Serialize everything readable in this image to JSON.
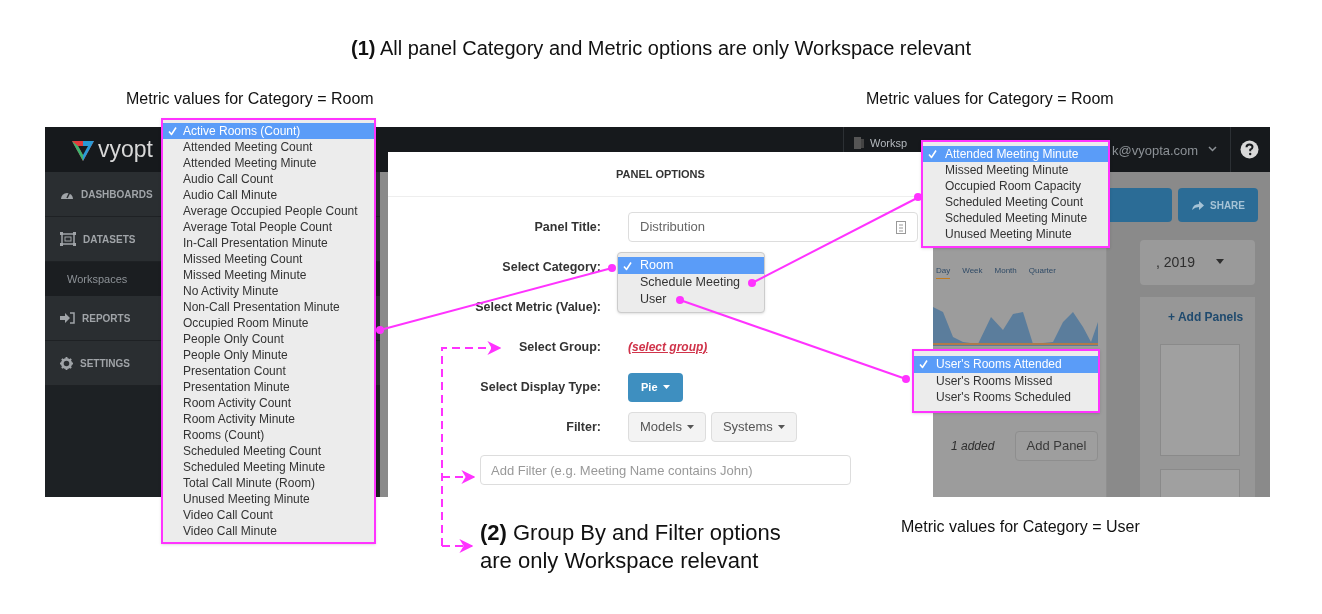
{
  "headline": "**(1)** All panel Category and Metric options are only Workspace relevant",
  "captions": [
    {
      "text": "Metric values for Category = Room"
    },
    {
      "text": "Metric values for Category = Room"
    },
    {
      "text": "Metric values for Category = User"
    }
  ],
  "note": "**(2)** Group By and Filter options\nare only Workspace relevant",
  "app": {
    "logo": "vyopt",
    "workspace": "Worksp",
    "user": "k@vyopta.com",
    "nav": [
      {
        "label": "DASHBOARDS",
        "kind": "gauge"
      },
      {
        "label": "DATASETS",
        "kind": "box"
      },
      {
        "label": "Workspaces",
        "kind": "sub"
      },
      {
        "label": "REPORTS",
        "kind": "enter"
      },
      {
        "label": "SETTINGS",
        "kind": "gear"
      }
    ],
    "share": "SHARE",
    "date": ", 2019",
    "chart_tabs": [
      {
        "label": "Day",
        "selected": true
      },
      {
        "label": "Week",
        "selected": false
      },
      {
        "label": "Month",
        "selected": false
      },
      {
        "label": "Quarter",
        "selected": false
      }
    ],
    "add_panels": "+ Add Panels",
    "added": "1 added",
    "add_panel": "Add Panel"
  },
  "modal": {
    "title": "PANEL OPTIONS",
    "rows": [
      {
        "label": "Panel Title:",
        "kind": "input",
        "value": "Distribution"
      },
      {
        "label": "Select Category:",
        "kind": "none"
      },
      {
        "label": "Select Metric (Value):",
        "kind": "none"
      },
      {
        "label": "Select Group:",
        "kind": "link",
        "value": "(select group)"
      },
      {
        "label": "Select Display Type:",
        "kind": "primary",
        "value": "Pie"
      },
      {
        "label": "Filter:",
        "kind": "buttons",
        "values": [
          "Models",
          "Systems"
        ]
      }
    ],
    "filter_placeholder": "Add Filter (e.g. Meeting Name contains John)"
  },
  "room_metrics": [
    {
      "label": "Active Rooms (Count)",
      "selected": true
    },
    {
      "label": "Attended Meeting Count",
      "selected": false
    },
    {
      "label": "Attended Meeting Minute",
      "selected": false
    },
    {
      "label": "Audio Call Count",
      "selected": false
    },
    {
      "label": "Audio Call Minute",
      "selected": false
    },
    {
      "label": "Average Occupied People Count",
      "selected": false
    },
    {
      "label": "Average Total People Count",
      "selected": false
    },
    {
      "label": "In-Call Presentation Minute",
      "selected": false
    },
    {
      "label": "Missed Meeting Count",
      "selected": false
    },
    {
      "label": "Missed Meeting Minute",
      "selected": false
    },
    {
      "label": "No Activity Minute",
      "selected": false
    },
    {
      "label": "Non-Call Presentation Minute",
      "selected": false
    },
    {
      "label": "Occupied Room Minute",
      "selected": false
    },
    {
      "label": "People Only Count",
      "selected": false
    },
    {
      "label": "People Only Minute",
      "selected": false
    },
    {
      "label": "Presentation Count",
      "selected": false
    },
    {
      "label": "Presentation Minute",
      "selected": false
    },
    {
      "label": "Room Activity Count",
      "selected": false
    },
    {
      "label": "Room Activity Minute",
      "selected": false
    },
    {
      "label": "Rooms (Count)",
      "selected": false
    },
    {
      "label": "Scheduled Meeting Count",
      "selected": false
    },
    {
      "label": "Scheduled Meeting Minute",
      "selected": false
    },
    {
      "label": "Total Call Minute (Room)",
      "selected": false
    },
    {
      "label": "Unused Meeting Minute",
      "selected": false
    },
    {
      "label": "Video Call Count",
      "selected": false
    },
    {
      "label": "Video Call Minute",
      "selected": false
    }
  ],
  "categories": [
    {
      "label": "Room",
      "selected": true
    },
    {
      "label": "Schedule Meeting",
      "selected": false
    },
    {
      "label": "User",
      "selected": false
    }
  ],
  "schedule_metrics": [
    {
      "label": "Attended Meeting Minute",
      "selected": true
    },
    {
      "label": "Missed Meeting Minute",
      "selected": false
    },
    {
      "label": "Occupied Room Capacity",
      "selected": false
    },
    {
      "label": "Scheduled Meeting Count",
      "selected": false
    },
    {
      "label": "Scheduled Meeting Minute",
      "selected": false
    },
    {
      "label": "Unused Meeting Minute",
      "selected": false
    }
  ],
  "user_metrics": [
    {
      "label": "User's Rooms Attended",
      "selected": true
    },
    {
      "label": "User's Rooms Missed",
      "selected": false
    },
    {
      "label": "User's Rooms Scheduled",
      "selected": false
    }
  ]
}
